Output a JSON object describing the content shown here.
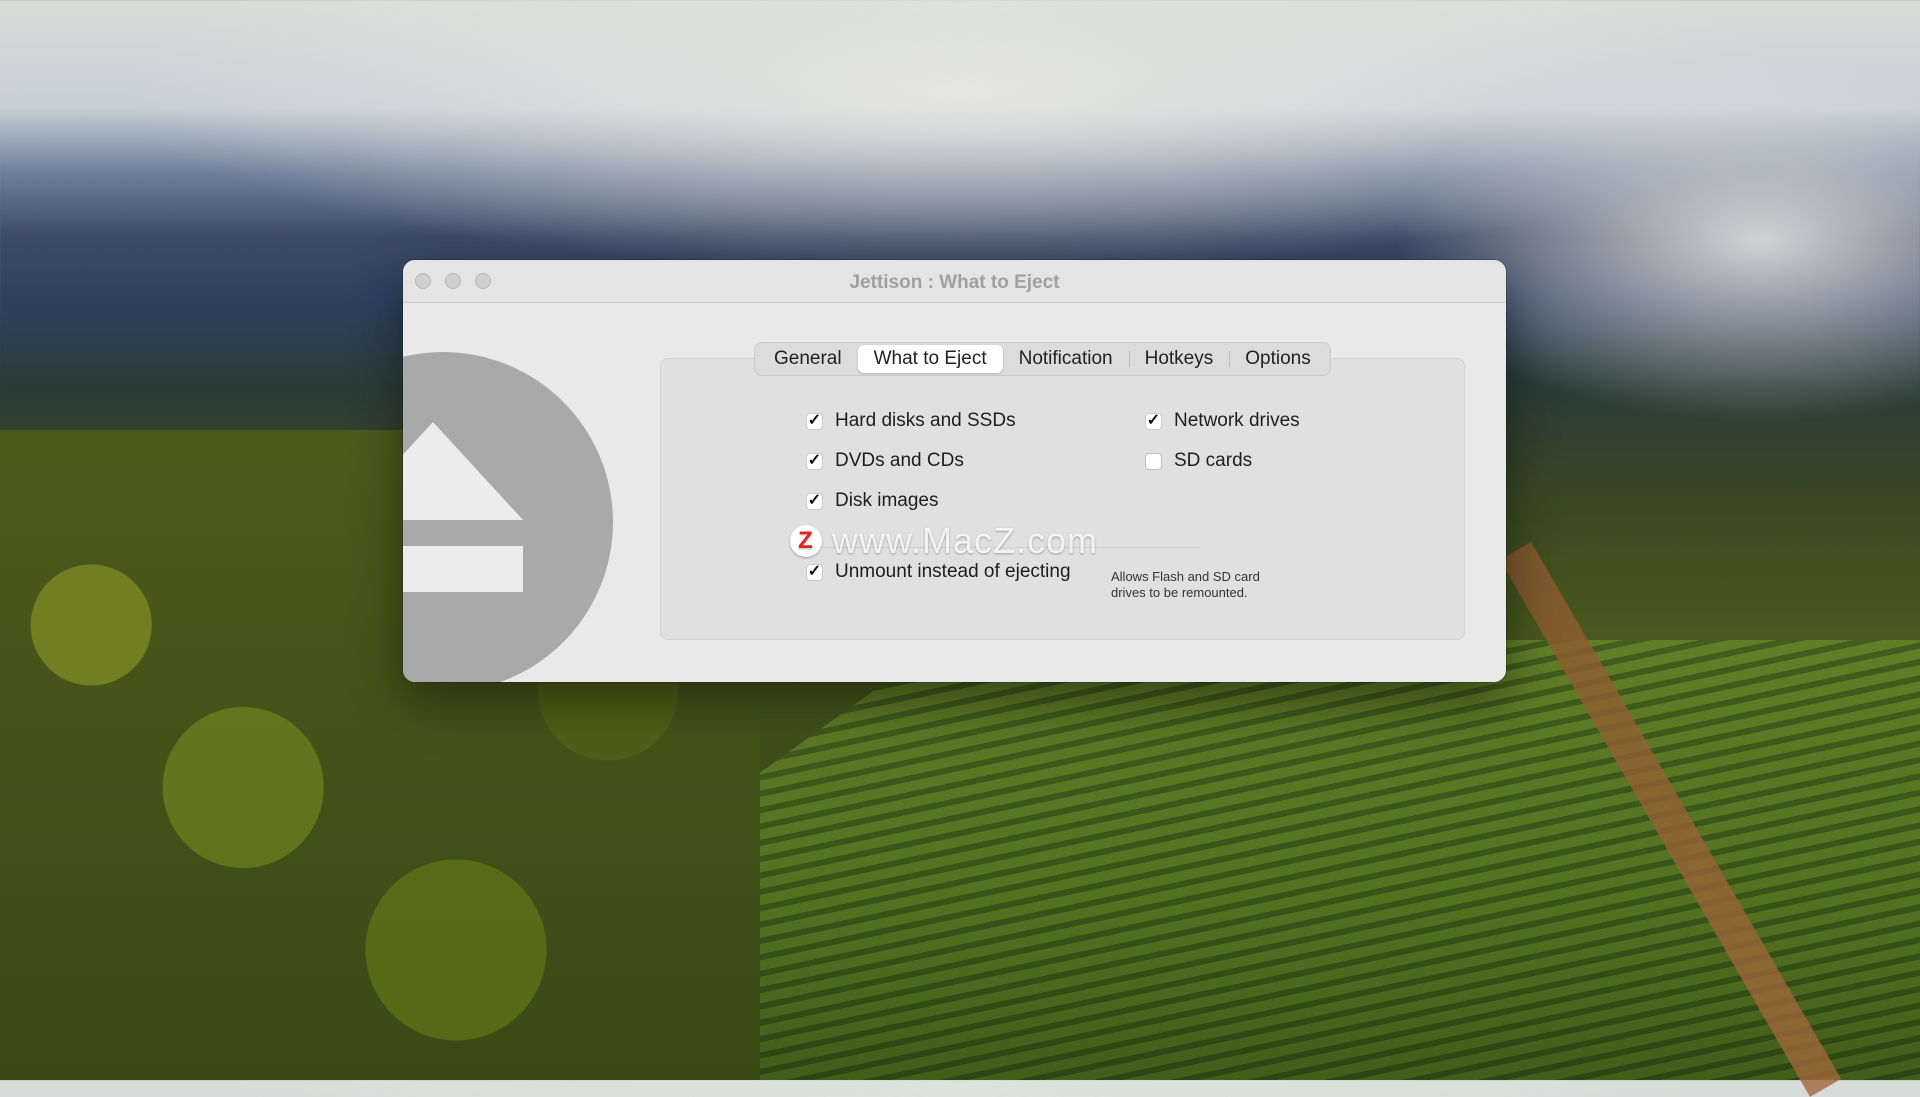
{
  "window": {
    "title": "Jettison : What to Eject"
  },
  "tabs": [
    {
      "label": "General",
      "active": false
    },
    {
      "label": "What to Eject",
      "active": true
    },
    {
      "label": "Notification",
      "active": false
    },
    {
      "label": "Hotkeys",
      "active": false
    },
    {
      "label": "Options",
      "active": false
    }
  ],
  "options": {
    "hard_disks": {
      "label": "Hard disks and SSDs",
      "checked": true
    },
    "network_drives": {
      "label": "Network drives",
      "checked": true
    },
    "dvds": {
      "label": "DVDs and CDs",
      "checked": true
    },
    "sd_cards": {
      "label": "SD cards",
      "checked": false
    },
    "disk_images": {
      "label": "Disk images",
      "checked": true
    },
    "unmount": {
      "label": "Unmount instead of ejecting",
      "checked": true
    }
  },
  "hint": "Allows Flash and SD card drives to be remounted.",
  "watermark": {
    "logo_letter": "Z",
    "text": "www.MacZ.com"
  },
  "colors": {
    "window_bg": "#e9e9e9",
    "panel_bg": "#e0e0e0",
    "eject_icon": "#a9a9a9"
  }
}
